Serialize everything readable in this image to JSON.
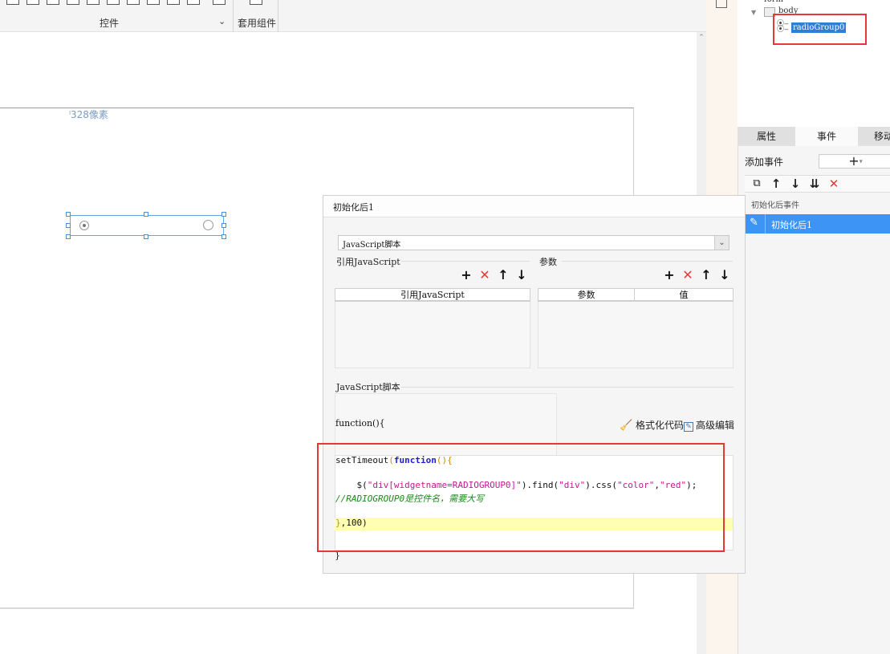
{
  "ribbon": {
    "group_controls_label": "控件",
    "group_template_label": "套用组件"
  },
  "canvas": {
    "width_label": "328像素"
  },
  "widget_tree": {
    "root": "form",
    "body": "body",
    "selected": "radioGroup0"
  },
  "side_panel": {
    "tabs": [
      "属性",
      "事件",
      "移动"
    ],
    "active_tab": "事件",
    "add_event_label": "添加事件",
    "add_event_button": "+",
    "event_group": "初始化后事件",
    "event_item": "初始化后1"
  },
  "dialog": {
    "title": "初始化后1",
    "type_selected": "JavaScript脚本",
    "ref_js_section": "引用JavaScript",
    "params_section": "参数",
    "ref_js_column": "引用JavaScript",
    "param_columns": [
      "参数",
      "值"
    ],
    "script_section": "JavaScript脚本",
    "function_header": "function(){",
    "format_code_label": "格式化代码",
    "advanced_edit_label": "高级编辑",
    "closing_brace": "}",
    "code": {
      "line1_a": "setTimeout",
      "line1_b": "(",
      "line1_c": "function",
      "line1_d": "(){",
      "line2_a": "    $(",
      "line2_b": "\"div[widgetname=RADIOGROUP0]\"",
      "line2_c": ").find(",
      "line2_d": "\"div\"",
      "line2_e": ").css(",
      "line2_f": "\"color\"",
      "line2_g": ",",
      "line2_h": "\"red\"",
      "line2_i": ");",
      "line3": "//RADIOGROUP0是控件名，需要大写",
      "line4_a": "}",
      "line4_b": ",100)"
    }
  },
  "colors": {
    "accent": "#3d94f5",
    "annotation": "#e53935",
    "code_highlight": "#ffffb3"
  }
}
